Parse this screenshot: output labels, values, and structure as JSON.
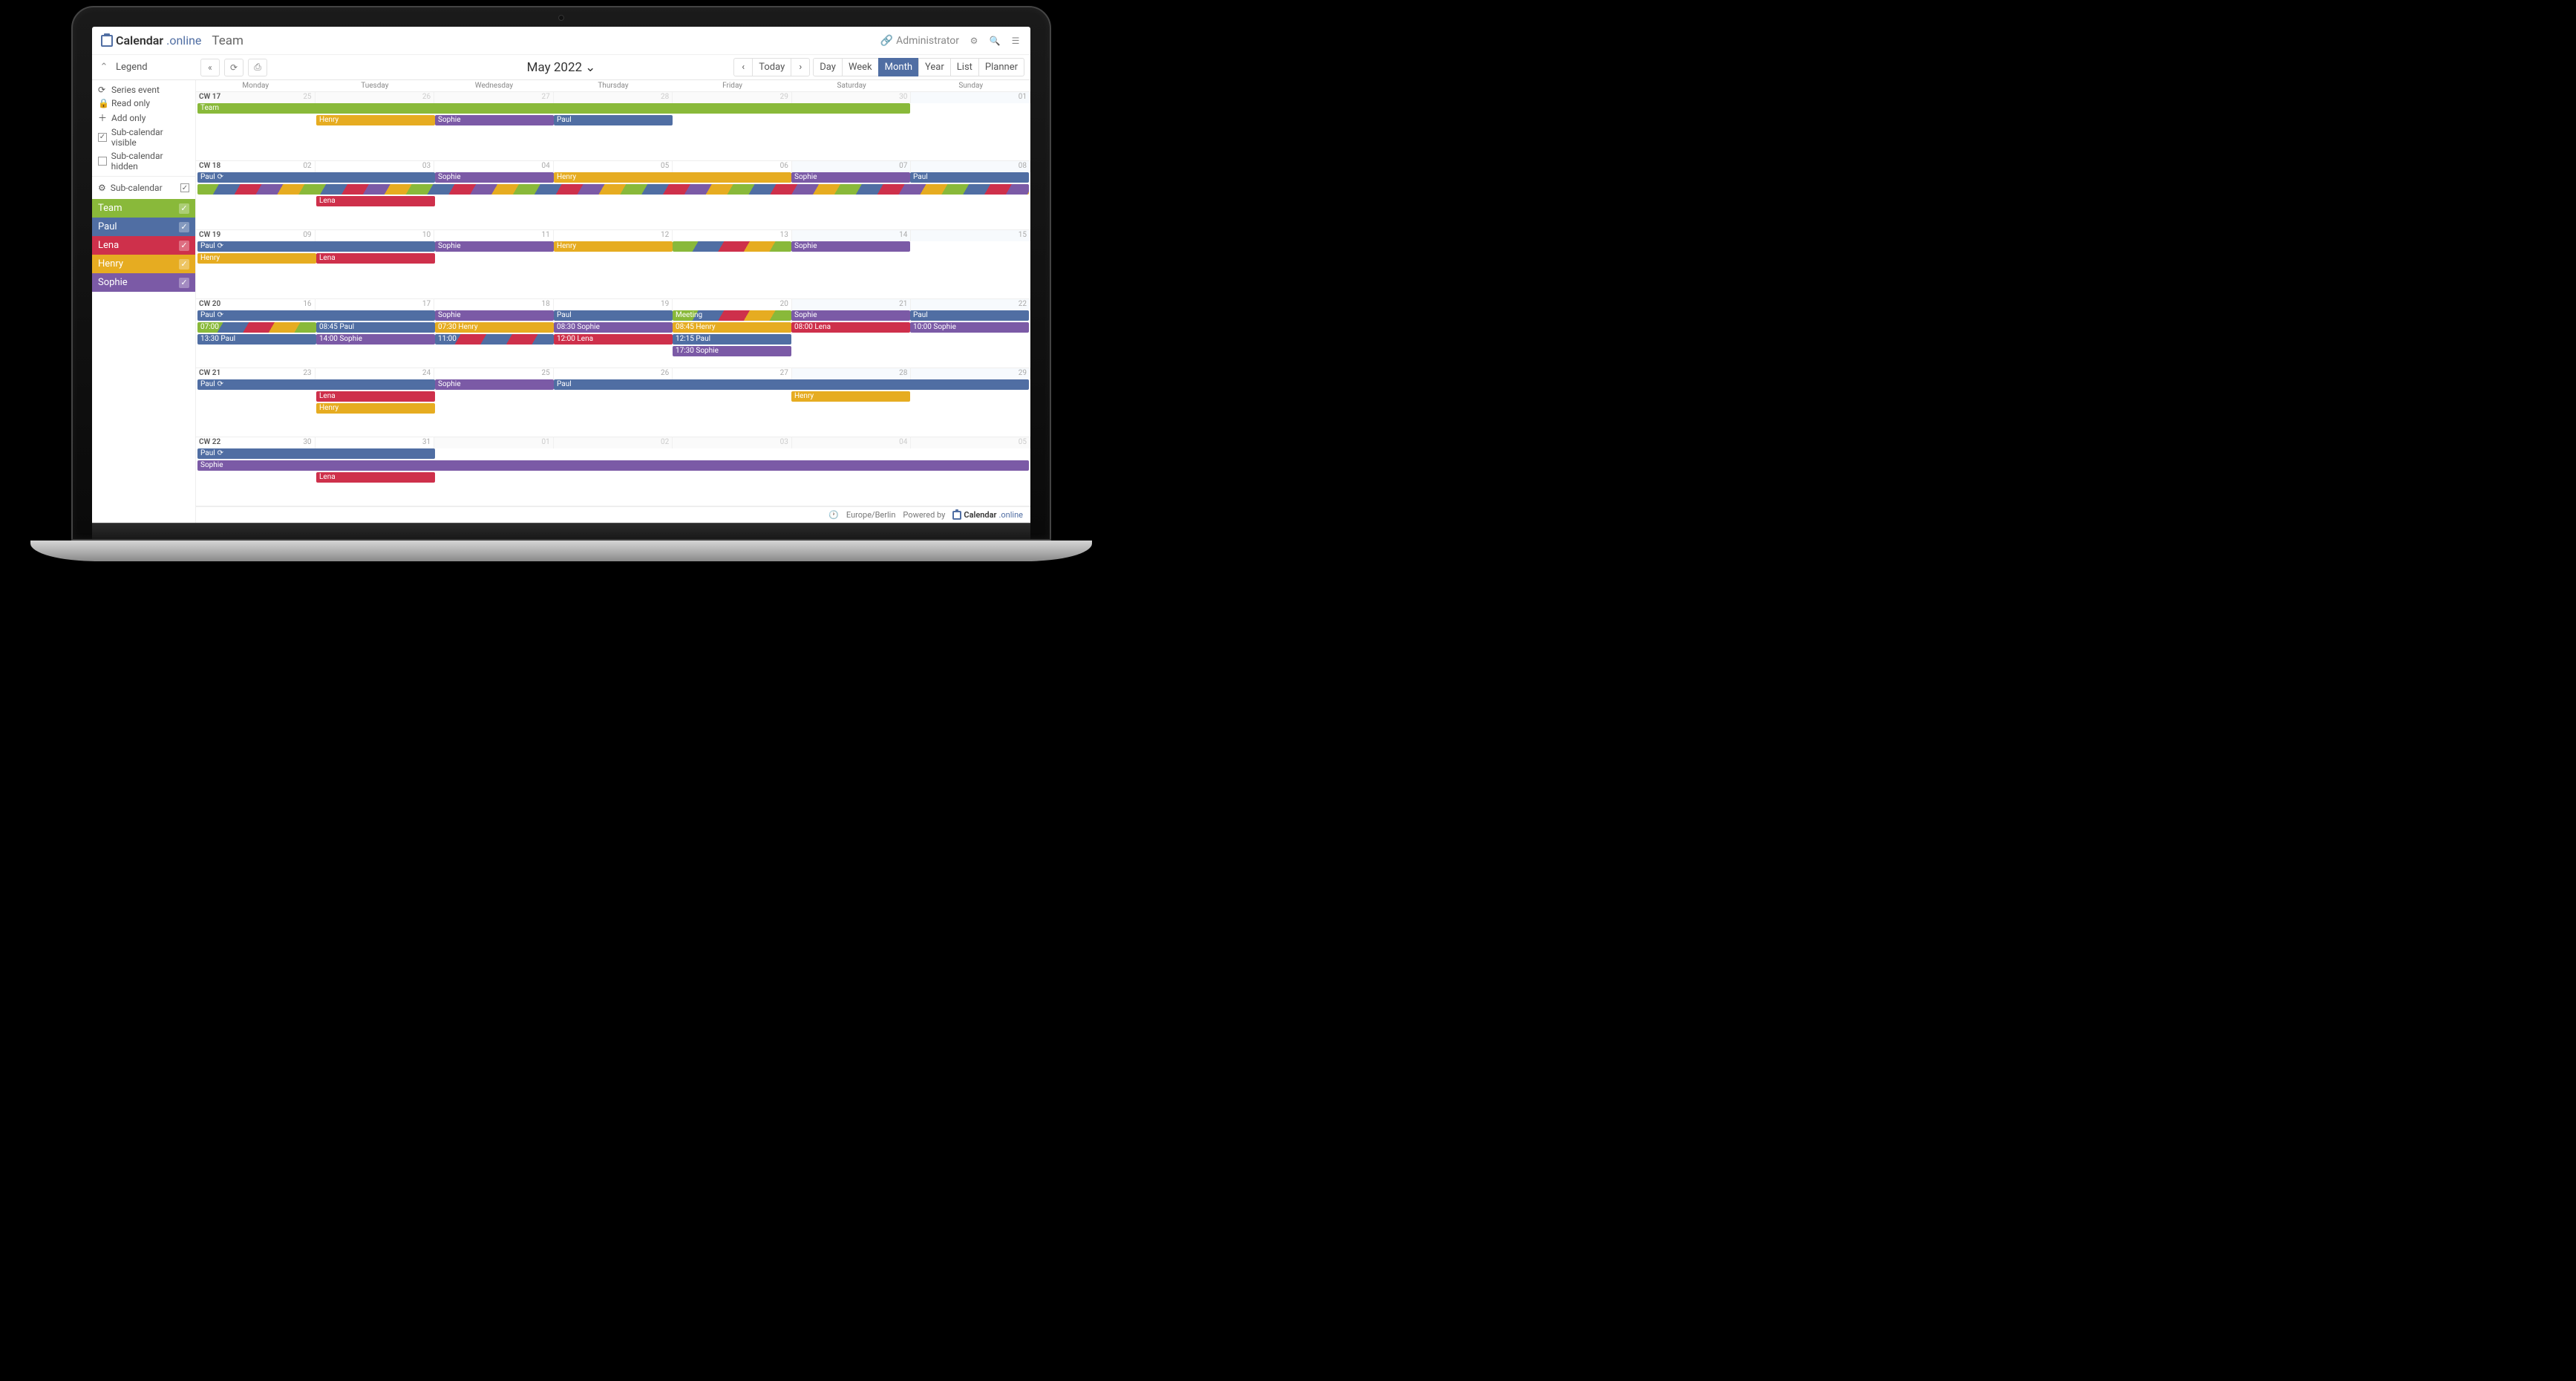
{
  "colors": {
    "team": "#89b93a",
    "paul": "#506ea3",
    "lena": "#ce304b",
    "henry": "#e6ac21",
    "sophie": "#7b5aa6"
  },
  "brand": {
    "name": "Calendar",
    "suffix": ".online"
  },
  "page_title": "Team",
  "admin_label": "Administrator",
  "toolbar": {
    "today": "Today",
    "month_label": "May 2022",
    "views": [
      "Day",
      "Week",
      "Month",
      "Year",
      "List",
      "Planner"
    ],
    "active_view": "Month"
  },
  "legend": {
    "title": "Legend",
    "items": [
      {
        "icon": "refresh",
        "label": "Series event"
      },
      {
        "icon": "lock",
        "label": "Read only"
      },
      {
        "icon": "plus",
        "label": "Add only"
      },
      {
        "icon": "chk-on",
        "label": "Sub-calendar visible"
      },
      {
        "icon": "chk-off",
        "label": "Sub-calendar hidden"
      }
    ]
  },
  "subcal": {
    "title": "Sub-calendar",
    "items": [
      {
        "name": "Team",
        "color": "#89b93a"
      },
      {
        "name": "Paul",
        "color": "#506ea3"
      },
      {
        "name": "Lena",
        "color": "#ce304b"
      },
      {
        "name": "Henry",
        "color": "#e6ac21"
      },
      {
        "name": "Sophie",
        "color": "#7b5aa6"
      }
    ]
  },
  "dow": [
    "Monday",
    "Tuesday",
    "Wednesday",
    "Thursday",
    "Friday",
    "Saturday",
    "Sunday"
  ],
  "weeks": [
    {
      "cw": "CW 17",
      "days": [
        {
          "n": "25",
          "other": true
        },
        {
          "n": "26",
          "other": true
        },
        {
          "n": "27",
          "other": true
        },
        {
          "n": "28",
          "other": true
        },
        {
          "n": "29",
          "other": true
        },
        {
          "n": "30",
          "other": true,
          "weekend": true
        },
        {
          "n": "01",
          "weekend": true
        }
      ],
      "rows": [
        [
          {
            "start": 1,
            "span": 6,
            "label": "Team",
            "color": "#89b93a"
          }
        ],
        [
          {
            "start": 2,
            "span": 1,
            "label": "Henry",
            "color": "#e6ac21"
          },
          {
            "start": 3,
            "span": 1,
            "label": "Sophie",
            "color": "#7b5aa6"
          },
          {
            "start": 4,
            "span": 1,
            "label": "Paul",
            "color": "#506ea3"
          }
        ]
      ]
    },
    {
      "cw": "CW 18",
      "days": [
        {
          "n": "02"
        },
        {
          "n": "03"
        },
        {
          "n": "04"
        },
        {
          "n": "05"
        },
        {
          "n": "06"
        },
        {
          "n": "07",
          "weekend": true
        },
        {
          "n": "08",
          "weekend": true
        }
      ],
      "rows": [
        [
          {
            "start": 1,
            "span": 2,
            "label": "Paul",
            "color": "#506ea3",
            "recur": true
          },
          {
            "start": 3,
            "span": 1,
            "label": "Sophie",
            "color": "#7b5aa6"
          },
          {
            "start": 4,
            "span": 2,
            "label": "Henry",
            "color": "#e6ac21"
          },
          {
            "start": 6,
            "span": 1,
            "label": "Sophie",
            "color": "#7b5aa6"
          },
          {
            "start": 7,
            "span": 1,
            "label": "Paul",
            "color": "#506ea3"
          }
        ],
        [
          {
            "start": 1,
            "span": 7,
            "label": "",
            "striped": "full2"
          }
        ],
        [
          {
            "start": 2,
            "span": 1,
            "label": "Lena",
            "color": "#ce304b"
          }
        ]
      ]
    },
    {
      "cw": "CW 19",
      "days": [
        {
          "n": "09"
        },
        {
          "n": "10"
        },
        {
          "n": "11"
        },
        {
          "n": "12"
        },
        {
          "n": "13"
        },
        {
          "n": "14",
          "weekend": true
        },
        {
          "n": "15",
          "weekend": true
        }
      ],
      "rows": [
        [
          {
            "start": 1,
            "span": 2,
            "label": "Paul",
            "color": "#506ea3",
            "recur": true
          },
          {
            "start": 3,
            "span": 1,
            "label": "Sophie",
            "color": "#7b5aa6"
          },
          {
            "start": 4,
            "span": 1,
            "label": "Henry",
            "color": "#e6ac21"
          },
          {
            "start": 5,
            "span": 1,
            "label": "",
            "striped": "full"
          },
          {
            "start": 6,
            "span": 1,
            "label": "Sophie",
            "color": "#7b5aa6"
          }
        ],
        [
          {
            "start": 1,
            "span": 1,
            "label": "Henry",
            "color": "#e6ac21"
          },
          {
            "start": 2,
            "span": 1,
            "label": "Lena",
            "color": "#ce304b"
          }
        ]
      ]
    },
    {
      "cw": "CW 20",
      "days": [
        {
          "n": "16"
        },
        {
          "n": "17"
        },
        {
          "n": "18"
        },
        {
          "n": "19"
        },
        {
          "n": "20"
        },
        {
          "n": "21",
          "weekend": true
        },
        {
          "n": "22",
          "weekend": true
        }
      ],
      "rows": [
        [
          {
            "start": 1,
            "span": 2,
            "label": "Paul",
            "color": "#506ea3",
            "recur": true
          },
          {
            "start": 3,
            "span": 1,
            "label": "Sophie",
            "color": "#7b5aa6"
          },
          {
            "start": 4,
            "span": 1,
            "label": "Paul",
            "color": "#506ea3"
          },
          {
            "start": 5,
            "span": 1,
            "label": "Meeting",
            "striped": "full"
          },
          {
            "start": 6,
            "span": 1,
            "label": "Sophie",
            "color": "#7b5aa6"
          },
          {
            "start": 7,
            "span": 1,
            "label": "Paul",
            "color": "#506ea3"
          }
        ],
        [
          {
            "start": 1,
            "span": 1,
            "label": "07:00",
            "striped": "full"
          },
          {
            "start": 2,
            "span": 1,
            "label": "08:45 Paul",
            "color": "#506ea3"
          },
          {
            "start": 3,
            "span": 1,
            "label": "07:30 Henry",
            "color": "#e6ac21"
          },
          {
            "start": 4,
            "span": 1,
            "label": "08:30 Sophie",
            "color": "#7b5aa6"
          },
          {
            "start": 5,
            "span": 1,
            "label": "08:45 Henry",
            "color": "#e6ac21"
          },
          {
            "start": 6,
            "span": 1,
            "label": "08:00 Lena",
            "color": "#ce304b"
          },
          {
            "start": 7,
            "span": 1,
            "label": "10:00 Sophie",
            "color": "#7b5aa6"
          }
        ],
        [
          {
            "start": 1,
            "span": 1,
            "label": "13:30 Paul",
            "color": "#506ea3"
          },
          {
            "start": 2,
            "span": 1,
            "label": "14:00 Sophie",
            "color": "#7b5aa6"
          },
          {
            "start": 3,
            "span": 1,
            "label": "11:00",
            "striped": "bluered"
          },
          {
            "start": 4,
            "span": 1,
            "label": "12:00 Lena",
            "color": "#ce304b"
          },
          {
            "start": 5,
            "span": 1,
            "label": "12:15 Paul",
            "color": "#506ea3"
          }
        ],
        [
          {
            "start": 5,
            "span": 1,
            "label": "17:30 Sophie",
            "color": "#7b5aa6"
          }
        ]
      ]
    },
    {
      "cw": "CW 21",
      "days": [
        {
          "n": "23"
        },
        {
          "n": "24"
        },
        {
          "n": "25"
        },
        {
          "n": "26"
        },
        {
          "n": "27"
        },
        {
          "n": "28",
          "weekend": true
        },
        {
          "n": "29",
          "weekend": true
        }
      ],
      "rows": [
        [
          {
            "start": 1,
            "span": 2,
            "label": "Paul",
            "color": "#506ea3",
            "recur": true
          },
          {
            "start": 3,
            "span": 1,
            "label": "Sophie",
            "color": "#7b5aa6"
          },
          {
            "start": 4,
            "span": 4,
            "label": "Paul",
            "color": "#506ea3"
          }
        ],
        [
          {
            "start": 2,
            "span": 1,
            "label": "Lena",
            "color": "#ce304b"
          },
          {
            "start": 6,
            "span": 1,
            "label": "Henry",
            "color": "#e6ac21"
          }
        ],
        [
          {
            "start": 2,
            "span": 1,
            "label": "Henry",
            "color": "#e6ac21"
          }
        ]
      ]
    },
    {
      "cw": "CW 22",
      "days": [
        {
          "n": "30"
        },
        {
          "n": "31"
        },
        {
          "n": "01",
          "other": true
        },
        {
          "n": "02",
          "other": true
        },
        {
          "n": "03",
          "other": true
        },
        {
          "n": "04",
          "other": true,
          "weekend": true
        },
        {
          "n": "05",
          "other": true,
          "weekend": true
        }
      ],
      "rows": [
        [
          {
            "start": 1,
            "span": 2,
            "label": "Paul",
            "color": "#506ea3",
            "recur": true
          }
        ],
        [
          {
            "start": 1,
            "span": 7,
            "label": "Sophie",
            "color": "#7b5aa6"
          }
        ],
        [
          {
            "start": 2,
            "span": 1,
            "label": "Lena",
            "color": "#ce304b"
          }
        ]
      ]
    }
  ],
  "footer": {
    "tz": "Europe/Berlin",
    "powered": "Powered by"
  }
}
